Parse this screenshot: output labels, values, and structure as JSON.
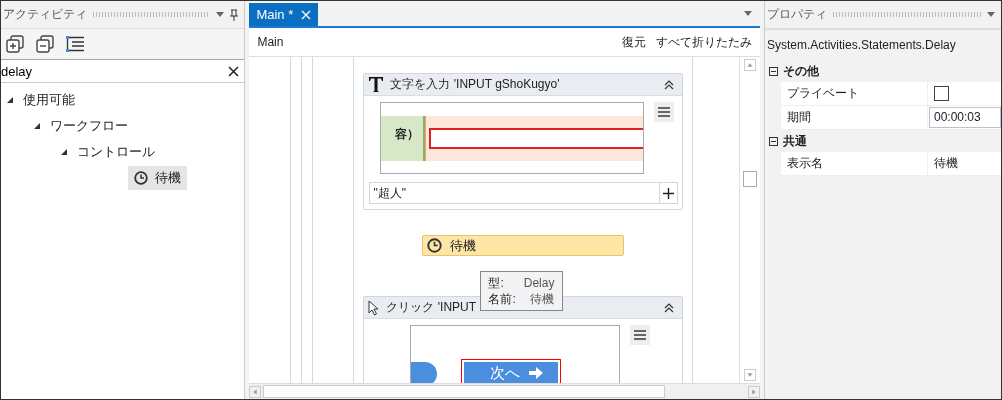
{
  "activities_panel": {
    "title": "アクティビティ",
    "search": {
      "value": "delay"
    },
    "tree": [
      {
        "label": "使用可能",
        "expanded": true,
        "children": [
          {
            "label": "ワークフロー",
            "expanded": true,
            "children": [
              {
                "label": "コントロール",
                "expanded": true,
                "children": [
                  {
                    "label": "待機",
                    "selected": true
                  }
                ]
              }
            ]
          }
        ]
      }
    ]
  },
  "tabs": [
    {
      "label": "Main *",
      "selected": true
    }
  ],
  "designer": {
    "breadcrumb": "Main",
    "actions": [
      "復元",
      "すべて折りたたみ"
    ],
    "type_activity": {
      "title": "文字を入力 'INPUT  gShoKugyo'",
      "screenshot_label": "容）",
      "text_value": "\"超人\""
    },
    "delay_activity": {
      "label": "待機"
    },
    "tooltip": {
      "rows": [
        {
          "key": "型:",
          "value": "Delay"
        },
        {
          "key": "名前:",
          "value": "待機"
        }
      ]
    },
    "click_activity": {
      "title": "クリック 'INPUT",
      "button_label": "次へ"
    }
  },
  "properties": {
    "title": "プロパティ",
    "type_name": "System.Activities.Statements.Delay",
    "categories": [
      {
        "label": "その他",
        "expanded": true,
        "rows": [
          {
            "label": "プライベート",
            "kind": "checkbox",
            "checked": false
          },
          {
            "label": "期間",
            "kind": "text",
            "value": "00:00:03"
          }
        ]
      },
      {
        "label": "共通",
        "expanded": true,
        "rows": [
          {
            "label": "表示名",
            "kind": "plain",
            "value": "待機"
          }
        ]
      }
    ]
  }
}
